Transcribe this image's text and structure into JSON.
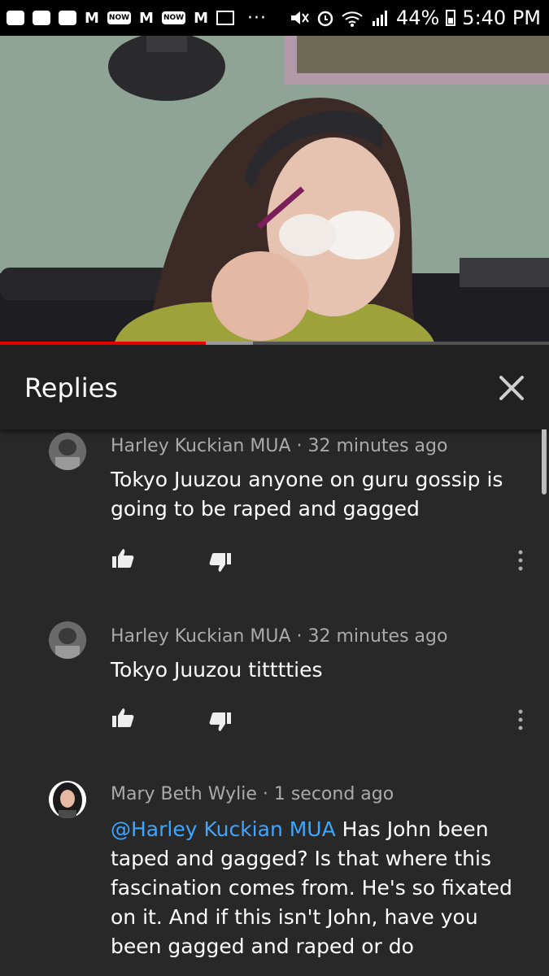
{
  "status_bar": {
    "icons": [
      "youtube-icon",
      "message-icon",
      "youtube-icon",
      "gmail-m-icon",
      "now-icon",
      "gmail-m-icon",
      "now-icon",
      "gmail-m-icon",
      "mail-icon"
    ],
    "m_label": "M",
    "now_label": "NOW",
    "more_dots": "···",
    "battery": "44%",
    "time": "5:40 PM"
  },
  "video": {
    "progress_fraction": 0.375,
    "buffered_fraction": 0.46,
    "colors": {
      "progress": "#ee0000",
      "wall": "#8ea295"
    }
  },
  "replies_panel": {
    "title": "Replies",
    "close_icon": "close-icon"
  },
  "comments": [
    {
      "author": "Harley Kuckian MUA",
      "separator": " · ",
      "time": "32 minutes ago",
      "text": "Tokyo Juuzou anyone on guru gossip is going to be raped and gagged"
    },
    {
      "author": "Harley Kuckian MUA",
      "separator": " · ",
      "time": "32 minutes ago",
      "text": "Tokyo Juuzou titttties"
    },
    {
      "author": "Mary Beth Wylie",
      "separator": " · ",
      "time": "1 second ago",
      "mention": "@Harley Kuckian MUA",
      "text": " Has John been taped and gagged? Is that where this fascination comes from. He's so fixated on it. And if this isn't John, have you been gagged and raped or do"
    }
  ],
  "colors": {
    "background": "#282828",
    "header": "#212121",
    "mention": "#3ea6ff",
    "meta": "#aaaaaa"
  }
}
